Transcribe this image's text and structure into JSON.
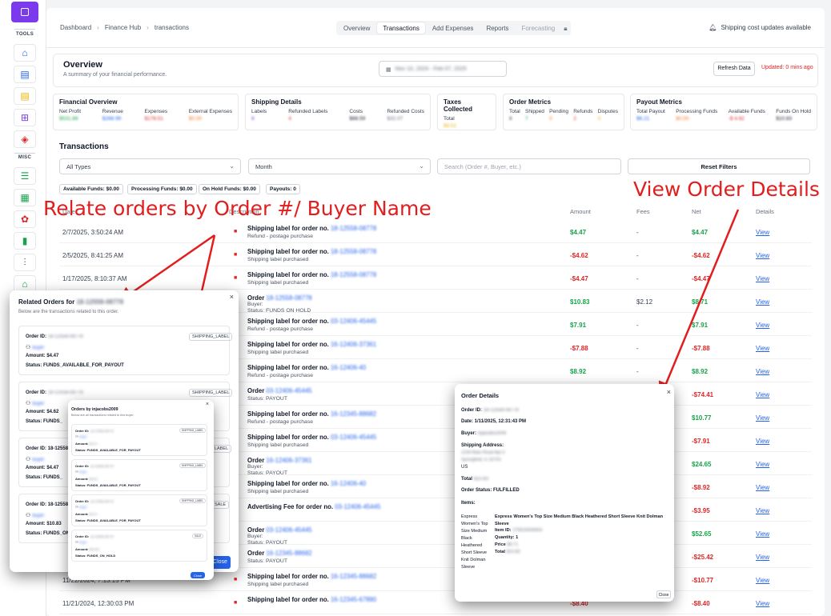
{
  "sidebar": {
    "tools_label": "TOOLS",
    "misc_label": "MISC"
  },
  "breadcrumb": [
    "Dashboard",
    "Finance Hub",
    "transactions"
  ],
  "tabs": [
    "Overview",
    "Transactions",
    "Add Expenses",
    "Reports",
    "Forecasting"
  ],
  "notice": "Shipping cost updates available",
  "overview": {
    "title": "Overview",
    "subtitle": "A summary of your financial performance.",
    "date_range": "Nov 10, 2024 - Feb 07, 2025",
    "refresh": "Refresh Data",
    "updated": "Updated: 0 mins ago"
  },
  "metrics": [
    {
      "title": "Financial Overview",
      "labels": [
        "Net Profit",
        "Revenue",
        "Expenses",
        "External Expenses"
      ],
      "values": [
        "$531.88",
        "$288.99",
        "$178.51",
        "$0.00"
      ]
    },
    {
      "title": "Shipping Details",
      "labels": [
        "Labels",
        "Refunded Labels",
        "Costs",
        "Refunded Costs"
      ],
      "values": [
        "8",
        "4",
        "$88.59",
        "$32.07"
      ]
    },
    {
      "title": "Taxes Collected",
      "labels": [
        "Total"
      ],
      "values": [
        "$9.51"
      ]
    },
    {
      "title": "Order Metrics",
      "labels": [
        "Total",
        "Shipped",
        "Pending",
        "Refunds",
        "Disputes"
      ],
      "values": [
        "8",
        "7",
        "0",
        "2",
        "0"
      ]
    },
    {
      "title": "Payout Metrics",
      "labels": [
        "Total Payout",
        "Processing Funds",
        "Available Funds",
        "Funds On Hold"
      ],
      "values": [
        "$6.21",
        "$0.00",
        "-$ 4.62",
        "$10.83"
      ]
    }
  ],
  "transactions": {
    "title": "Transactions",
    "filter_type": "All Types",
    "filter_period": "Month",
    "search_placeholder": "Search (Order #, Buyer, etc.)",
    "reset": "Reset Filters",
    "chips": [
      "Available Funds: $0.00",
      "Processing Funds: $0.00",
      "On Hold Funds: $0.00",
      "Payouts: 0"
    ],
    "headers": [
      "Date",
      "Description",
      "Amount",
      "Fees",
      "Net",
      "Details"
    ],
    "rows": [
      {
        "date": "2/7/2025, 3:50:24 AM",
        "line1": "Shipping label for order no.",
        "oid": "18-12558-08778",
        "line2": "Refund - postage purchase",
        "amount": "$4.47",
        "fee": "-",
        "net": "$4.47",
        "sign": "pos",
        "view": "View"
      },
      {
        "date": "2/5/2025, 8:41:25 AM",
        "line1": "Shipping label for order no.",
        "oid": "18-12558-08778",
        "line2": "Shipping label purchased",
        "amount": "-$4.62",
        "fee": "-",
        "net": "-$4.62",
        "sign": "neg",
        "view": "View"
      },
      {
        "date": "1/17/2025, 8:10:37 AM",
        "line1": "Shipping label for order no.",
        "oid": "18-12558-08778",
        "line2": "Shipping label purchased",
        "amount": "-$4.47",
        "fee": "-",
        "net": "-$4.47",
        "sign": "neg",
        "view": "View"
      },
      {
        "date": "",
        "line1": "Order",
        "oid": "18-12558-08778",
        "line2": "Status: FUNDS ON HOLD",
        "buyer": "Buyer:",
        "amount": "$10.83",
        "fee": "$2.12",
        "net": "$8.71",
        "sign": "pos",
        "view": "View"
      },
      {
        "date": "",
        "line1": "Shipping label for order no.",
        "oid": "03-12406-45445",
        "line2": "Refund - postage purchase",
        "amount": "$7.91",
        "fee": "-",
        "net": "$7.91",
        "sign": "pos",
        "view": "View"
      },
      {
        "date": "",
        "line1": "Shipping label for order no.",
        "oid": "16-12406-37361",
        "line2": "Shipping label purchased",
        "amount": "-$7.88",
        "fee": "-",
        "net": "-$7.88",
        "sign": "neg",
        "view": "View"
      },
      {
        "date": "",
        "line1": "Shipping label for order no.",
        "oid": "16-12406-40",
        "line2": "Refund - postage purchase",
        "amount": "$8.92",
        "fee": "-",
        "net": "$8.92",
        "sign": "pos",
        "view": "View"
      },
      {
        "date": "",
        "line1": "Order",
        "oid": "03-12406-45445",
        "line2": "Status: PAYOUT",
        "amount": "",
        "fee": "",
        "net": "-$74.41",
        "sign": "neg",
        "view": "View"
      },
      {
        "date": "",
        "line1": "Shipping label for order no.",
        "oid": "16-12345-88682",
        "line2": "Refund - postage purchase",
        "amount": "",
        "fee": "",
        "net": "$10.77",
        "sign": "pos",
        "view": "View"
      },
      {
        "date": "",
        "line1": "Shipping label for order no.",
        "oid": "03-12406-45445",
        "line2": "Shipping label purchased",
        "amount": "",
        "fee": "",
        "net": "-$7.91",
        "sign": "neg",
        "view": "View"
      },
      {
        "date": "",
        "line1": "Order",
        "oid": "16-12406-37361",
        "line2": "Status: PAYOUT",
        "buyer": "Buyer:",
        "amount": "",
        "fee": "",
        "net": "$24.65",
        "sign": "pos",
        "view": "View"
      },
      {
        "date": "",
        "line1": "Shipping label for order no.",
        "oid": "16-12406-40",
        "line2": "Shipping label purchased",
        "amount": "",
        "fee": "",
        "net": "-$8.92",
        "sign": "neg",
        "view": "View"
      },
      {
        "date": "",
        "line1": "Advertising Fee for order no.",
        "oid": "03-12406-45445",
        "line2": "",
        "amount": "",
        "fee": "",
        "net": "-$3.95",
        "sign": "neg",
        "view": "View"
      },
      {
        "date": "",
        "line1": "Order",
        "oid": "03-12406-45445",
        "line2": "Status: PAYOUT",
        "buyer": "Buyer:",
        "amount": "",
        "fee": "",
        "net": "$52.65",
        "sign": "pos",
        "view": "View"
      },
      {
        "date": "",
        "line1": "Order",
        "oid": "16-12345-88682",
        "line2": "Status: PAYOUT",
        "amount": "",
        "fee": "",
        "net": "-$25.42",
        "sign": "neg",
        "view": "View"
      },
      {
        "date": "11/22/2024, 7:13:15 PM",
        "line1": "Shipping label for order no.",
        "oid": "16-12345-88682",
        "line2": "Shipping label purchased",
        "amount": "",
        "fee": "",
        "net": "-$10.77",
        "sign": "neg",
        "view": "View"
      },
      {
        "date": "11/21/2024, 12:30:03 PM",
        "line1": "Shipping label for order no.",
        "oid": "16-12345-67890",
        "line2": "",
        "amount": "-$8.40",
        "fee": "",
        "net": "-$8.40",
        "sign": "neg",
        "view": "View"
      }
    ]
  },
  "annotations": {
    "left": "Relate orders by Order #/ Buyer Name",
    "right": "View Order Details"
  },
  "related_modal": {
    "title": "Related Orders for",
    "title_id": "18-12558-08778",
    "subtitle": "Below are the transactions related to this order.",
    "cards": [
      {
        "order_label": "Order ID:",
        "order_id": "18-12558-08778",
        "badge": "SHIPPING_LABEL",
        "amount": "Amount: $4.47",
        "status": "Status: FUNDS_AVAILABLE_FOR_PAYOUT"
      },
      {
        "order_label": "Order ID:",
        "order_id": "18-12558-08778",
        "badge": "SHIPPING_LABEL",
        "amount": "Amount: $4.62",
        "status": "Status: FUNDS_"
      },
      {
        "order_label": "Order ID: 18-12558",
        "order_id": "",
        "badge": "LABEL",
        "amount": "Amount: $4.47",
        "status": "Status: FUNDS_"
      },
      {
        "order_label": "Order ID: 18-12558",
        "order_id": "",
        "badge": "SALE",
        "amount": "Amount: $10.83",
        "status": "Status: FUNDS_ON_"
      }
    ],
    "close": "Close"
  },
  "buyer_modal": {
    "title": "Orders by injacobs2009",
    "subtitle": "Below are all transactions related to this buyer.",
    "cards": [
      {
        "order_id": "18-12558-08778",
        "badge": "SHIPPING_LABEL",
        "amount": "Amount:",
        "amount_val": "$4.47",
        "status": "Status: FUNDS_AVAILABLE_FOR_PAYOUT"
      },
      {
        "order_id": "18-12558-08778",
        "badge": "SHIPPING_LABEL",
        "amount": "Amount:",
        "amount_val": "$4.62",
        "status": "Status: FUNDS_AVAILABLE_FOR_PAYOUT"
      },
      {
        "order_id": "18-12558-08778",
        "badge": "SHIPPING_LABEL",
        "amount": "Amount:",
        "amount_val": "$4.47",
        "status": "Status: FUNDS_AVAILABLE_FOR_PAYOUT"
      },
      {
        "order_id": "18-12558-08778",
        "badge": "SALE",
        "amount": "Amount:",
        "amount_val": "$10.83",
        "status": "Status: FUNDS_ON_HOLD"
      }
    ],
    "close": "Close"
  },
  "details_modal": {
    "title": "Order Details",
    "order_id_label": "Order ID:",
    "order_id": "18-12558-08778",
    "date": "Date: 1/11/2025, 12:31:43 PM",
    "buyer_label": "Buyer:",
    "buyer": "injacobs2009",
    "shipping_label": "Shipping Address:",
    "addr1": "1234 Main Road Apt 3",
    "addr2": "Springfield, IL 62701",
    "country": "US",
    "total_label": "Total",
    "total": "$10.83",
    "status": "Order Status: FULFILLED",
    "items_label": "Items:",
    "img_alt": "Express Women's Top Size Medium Black Heathered Short Sleeve Knit Dolman Sleeve",
    "item_title": "Express Women's Top Size Medium Black Heathered Short Sleeve Knit Dolman Sleeve",
    "item_id_label": "Item ID:",
    "item_id": "275816606654",
    "qty": "Quantity: 1",
    "price_label": "Price",
    "price": "$8.71",
    "item_total_label": "Total",
    "item_total": "$10.83",
    "close": "Close"
  }
}
